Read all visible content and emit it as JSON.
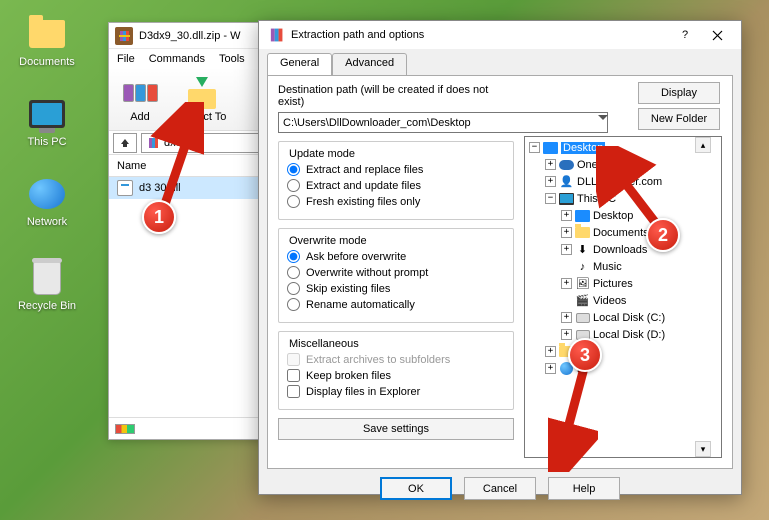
{
  "desktop": {
    "documents": "Documents",
    "thispc": "This PC",
    "network": "Network",
    "recycle": "Recycle Bin"
  },
  "winrar": {
    "title": "D3dx9_30.dll.zip - W",
    "menu": {
      "file": "File",
      "commands": "Commands",
      "tools": "Tools"
    },
    "toolbar": {
      "add": "Add",
      "extract_to": "Extract To"
    },
    "path": "dx9_30.",
    "col_name": "Name",
    "file1": "d3     30.dll"
  },
  "dialog": {
    "title": "Extraction path and options",
    "tabs": {
      "general": "General",
      "advanced": "Advanced"
    },
    "dest_label": "Destination path (will be created if does not exist)",
    "dest_value": "C:\\Users\\DllDownloader_com\\Desktop",
    "display_btn": "Display",
    "newfolder_btn": "New Folder",
    "update_mode": {
      "title": "Update mode",
      "opt_replace": "Extract and replace files",
      "opt_update": "Extract and update files",
      "opt_fresh": "Fresh existing files only"
    },
    "overwrite_mode": {
      "title": "Overwrite mode",
      "opt_ask": "Ask before overwrite",
      "opt_without": "Overwrite without prompt",
      "opt_skip": "Skip existing files",
      "opt_rename": "Rename automatically"
    },
    "misc": {
      "title": "Miscellaneous",
      "opt_subfolders": "Extract archives to subfolders",
      "opt_keepbroken": "Keep broken files",
      "opt_explorer": "Display files in Explorer"
    },
    "save_btn": "Save settings",
    "tree": {
      "desktop": "Desktop",
      "onedrive": "OneD",
      "dlldownloader": "DLL Do       ader.com",
      "thispc": "This PC",
      "desktop2": "Desktop",
      "documents": "Documents",
      "downloads": "Downloads",
      "music": "Music",
      "pictures": "Pictures",
      "videos": "Videos",
      "disk_c": "Local Disk (C:)",
      "disk_d": "Local Disk (D:)",
      "item_s": "s",
      "item_k": "k"
    },
    "buttons": {
      "ok": "OK",
      "cancel": "Cancel",
      "help": "Help"
    }
  }
}
